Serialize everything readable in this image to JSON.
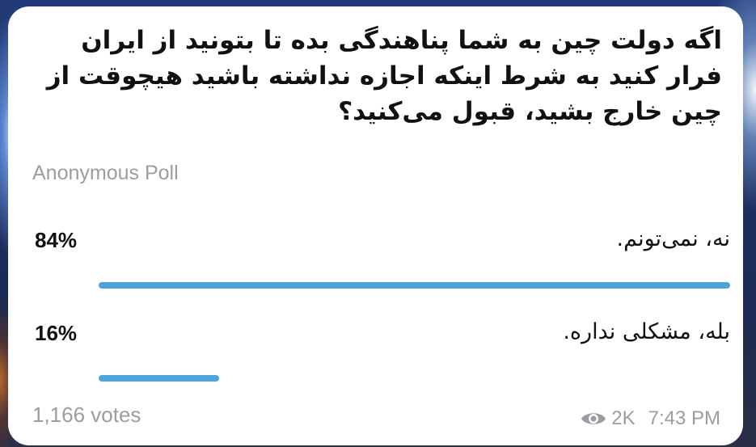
{
  "poll": {
    "question": "اگه دولت چین به شما پناهندگی بده تا بتونید از ایران فرار کنید به شرط اینکه اجازه نداشته باشید هیچوقت از چین خارج بشید، قبول می‌کنید؟",
    "type_label": "Anonymous Poll",
    "options": [
      {
        "text": "نه، نمی‌تونم.",
        "percent_label": "84%",
        "share": 84
      },
      {
        "text": "بله، مشکلی نداره.",
        "percent_label": "16%",
        "share": 16
      }
    ],
    "votes_label": "1,166 votes"
  },
  "message_meta": {
    "view_icon": "eye-icon",
    "views": "2K",
    "time": "7:43 PM"
  },
  "colors": {
    "bar": "#4ea4d9",
    "secondary_text": "#9a9ea3",
    "card_background": "#ffffff"
  }
}
